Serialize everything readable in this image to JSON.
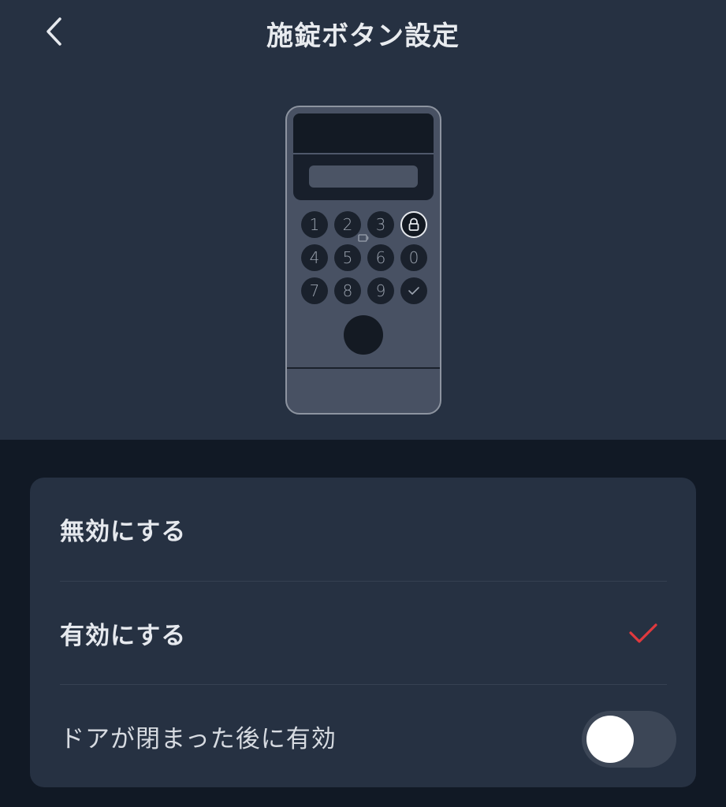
{
  "header": {
    "title": "施錠ボタン設定",
    "back_icon": "chevron-left-icon"
  },
  "device": {
    "keys": [
      "1",
      "2",
      "3",
      "4",
      "5",
      "6",
      "0",
      "7",
      "8",
      "9"
    ],
    "lock_key_icon": "lock-icon",
    "confirm_key_icon": "check-icon",
    "nfc_icon": "nfc-card-icon",
    "fingerprint_icon": "fingerprint-sensor"
  },
  "options": {
    "disable_label": "無効にする",
    "enable_label": "有効にする",
    "selected": "enable",
    "selected_icon": "check-icon",
    "check_color": "#e0393e",
    "after_close_label": "ドアが閉まった後に有効",
    "after_close_enabled": false
  }
}
